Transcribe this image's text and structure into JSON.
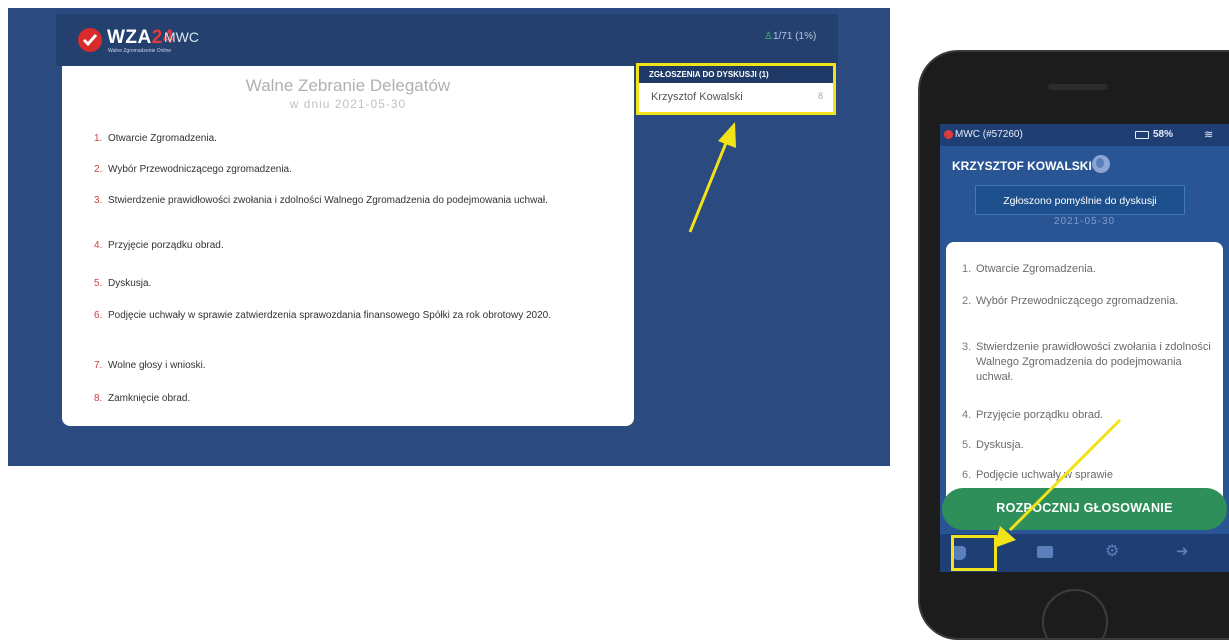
{
  "desktop": {
    "logo_pre": "WZA",
    "logo_accent": "24",
    "logo_sub": "Walne Zgromadzenie Online",
    "app_name": "MWC",
    "counter": "1/71 (1%)",
    "counter_icon": "person-icon",
    "meeting_title": "Walne Zebranie Delegatów",
    "meeting_date": "w dniu 2021-05-30",
    "agenda": [
      {
        "num": "1.",
        "text": "Otwarcie Zgromadzenia."
      },
      {
        "num": "2.",
        "text": "Wybór Przewodniczącego zgromadzenia."
      },
      {
        "num": "3.",
        "text": "Stwierdzenie prawidłowości zwołania i zdolności Walnego Zgromadzenia do podejmowania uchwał."
      },
      {
        "num": "4.",
        "text": "Przyjęcie porządku obrad."
      },
      {
        "num": "5.",
        "text": "Dyskusja."
      },
      {
        "num": "6.",
        "text": "Podjęcie uchwały w sprawie zatwierdzenia sprawozdania finansowego Spółki za rok obrotowy 2020."
      },
      {
        "num": "7.",
        "text": "Wolne głosy i wnioski."
      },
      {
        "num": "8.",
        "text": "Zamknięcie obrad."
      }
    ],
    "queue": {
      "header": "ZGŁOSZENIA DO DYSKUSJI (1)",
      "entries": [
        {
          "name": "Krzysztof Kowalski",
          "number": "8"
        }
      ]
    }
  },
  "phone": {
    "status_left": "MWC (#57260)",
    "battery": "58%",
    "user_name": "KRZYSZTOF KOWALSKI ...",
    "toast": "Zgłoszono pomyślnie do dyskusji",
    "date": "2021-05-30",
    "agenda": [
      {
        "num": "1.",
        "text": "Otwarcie Zgromadzenia."
      },
      {
        "num": "2.",
        "text": "Wybór Przewodniczącego zgromadzenia."
      },
      {
        "num": "3.",
        "text": "Stwierdzenie prawidłowości zwołania i zdolności Walnego Zgromadzenia do podejmowania uchwał."
      },
      {
        "num": "4.",
        "text": "Przyjęcie porządku obrad."
      },
      {
        "num": "5.",
        "text": "Dyskusja."
      },
      {
        "num": "6.",
        "text": "Podjęcie uchwały w sprawie"
      }
    ],
    "vote_button": "ROZPOCZNIJ GŁOSOWANIE",
    "nav": [
      {
        "icon": "raise-hand-icon"
      },
      {
        "icon": "chat-icon"
      },
      {
        "icon": "gear-icon"
      },
      {
        "icon": "logout-icon"
      }
    ]
  },
  "colors": {
    "highlight": "#f2e21a",
    "accent_red": "#d92b2b",
    "vote_green": "#2f8f5a",
    "background_blue": "#2b4a80"
  }
}
